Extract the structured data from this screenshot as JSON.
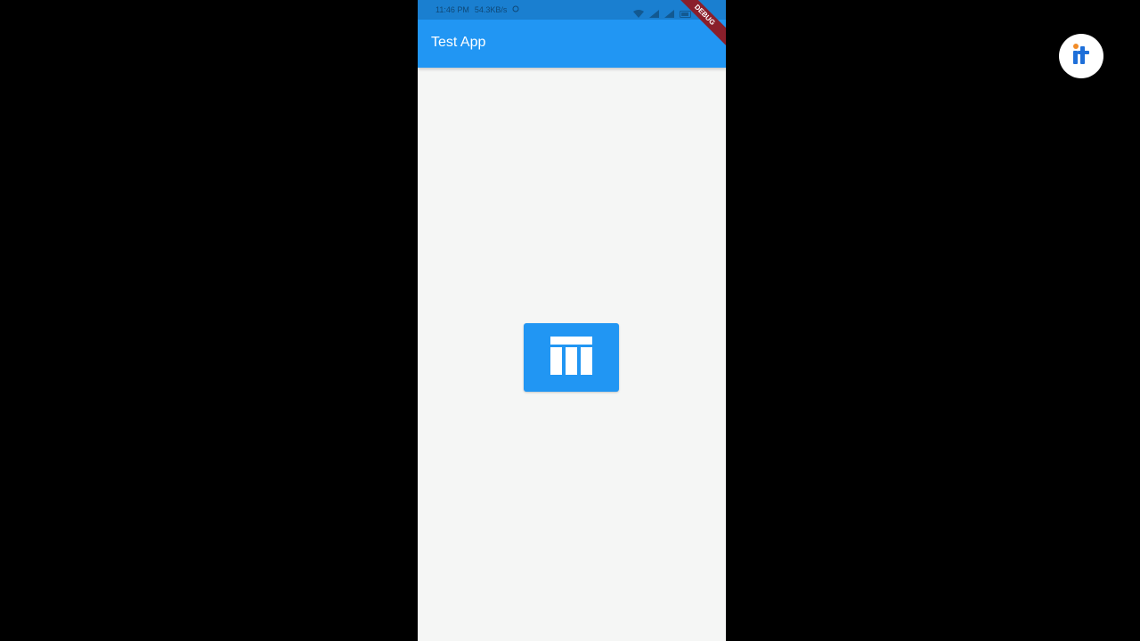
{
  "status_bar": {
    "time": "11:46 PM",
    "network_speed": "54.3KB/s",
    "background_color": "#1a7fd0"
  },
  "app_bar": {
    "title": "Test App",
    "color": "#2196f3"
  },
  "debug_banner": {
    "label": "DEBUG"
  },
  "main": {
    "action_button_icon": "table-layout-icon",
    "background_color": "#f5f6f5"
  },
  "overlay": {
    "logo_icon": "it-logo-icon"
  }
}
